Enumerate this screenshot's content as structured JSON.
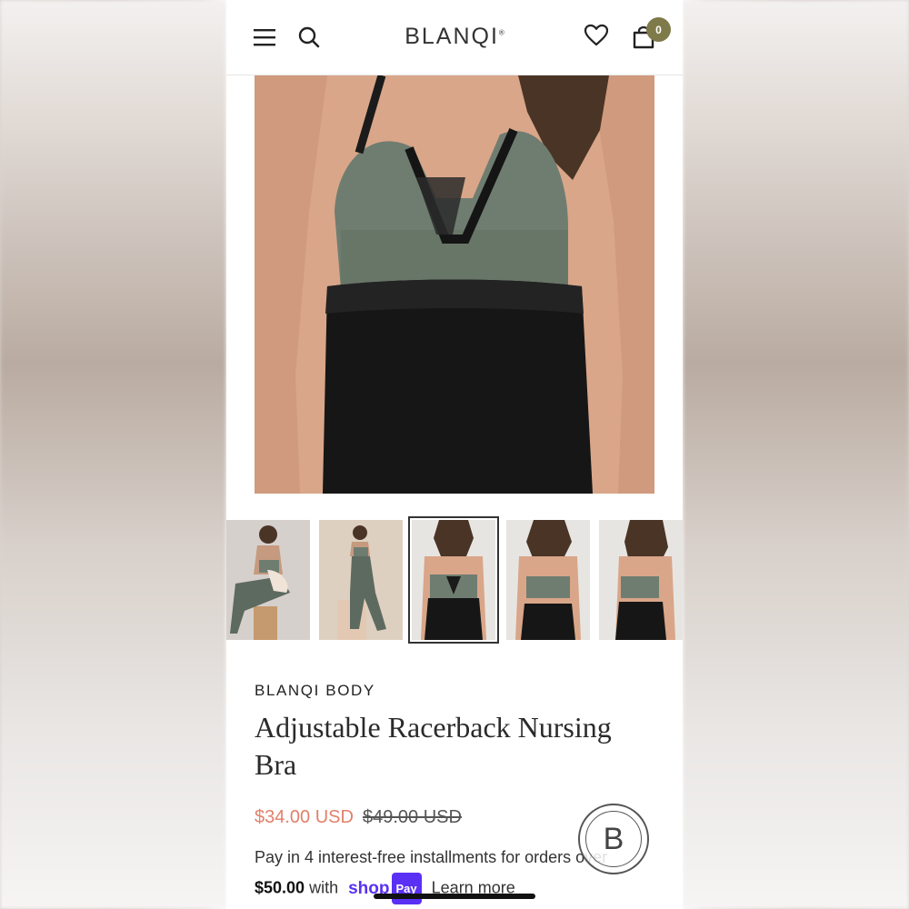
{
  "header": {
    "logo": "BLANQI",
    "logo_mark": "®",
    "cart_count": "0",
    "icons": [
      "menu-icon",
      "search-icon",
      "heart-icon",
      "cart-icon"
    ]
  },
  "gallery": {
    "thumbnail_count": 5,
    "active_index": 2,
    "zoom_icon": "zoom-icon"
  },
  "product": {
    "brand": "BLANQI BODY",
    "title_line1": "Adjustable Racerback Nursing",
    "title_line2": "Bra",
    "price_sale": "$34.00 USD",
    "price_original": "$49.00 USD",
    "installments_text": "Pay in 4 interest-free installments for orders over",
    "installments_threshold": "$50.00",
    "installments_with": "with",
    "shop_pay_shop": "shop",
    "shop_pay_pay": "Pay",
    "learn_more": "Learn more"
  },
  "badge": {
    "letter": "B"
  },
  "colors": {
    "sale": "#e2806b",
    "cart_badge": "#7f7a4a",
    "shop_pay": "#5a31f4",
    "bra_green": "#6f7d71",
    "legging_black": "#161616"
  }
}
